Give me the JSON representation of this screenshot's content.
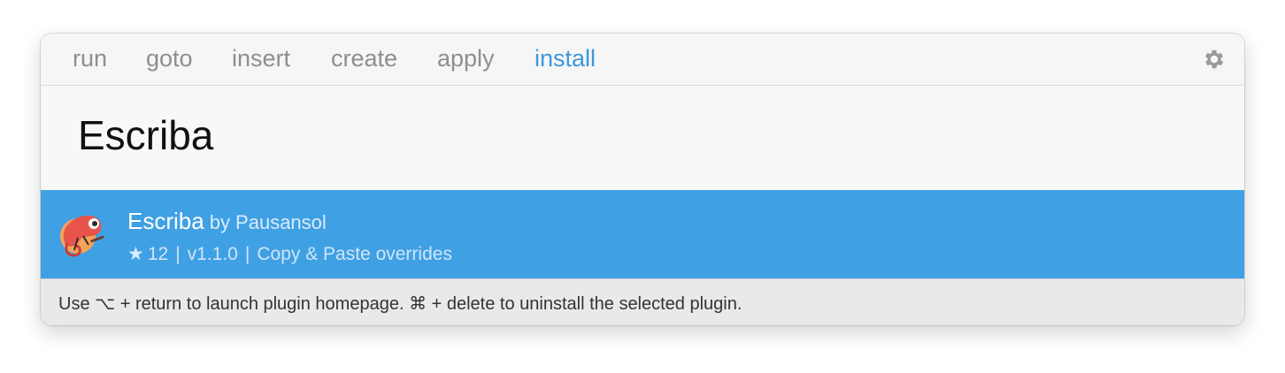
{
  "tabs": [
    {
      "label": "run"
    },
    {
      "label": "goto"
    },
    {
      "label": "insert"
    },
    {
      "label": "create"
    },
    {
      "label": "apply"
    },
    {
      "label": "install"
    }
  ],
  "active_tab": "install",
  "settings_icon": "gear-icon",
  "search": {
    "value": "Escriba"
  },
  "result": {
    "name": "Escriba",
    "author": "by Pausansol",
    "stars": "12",
    "version": "v1.1.0",
    "description": "Copy & Paste overrides",
    "separator": "|",
    "icon": "chameleon-icon"
  },
  "footer": {
    "hint": "Use ⌥ + return to launch plugin homepage. ⌘ + delete to uninstall the selected plugin."
  },
  "colors": {
    "accent": "#3c97dd",
    "selection": "#40a0e4"
  }
}
